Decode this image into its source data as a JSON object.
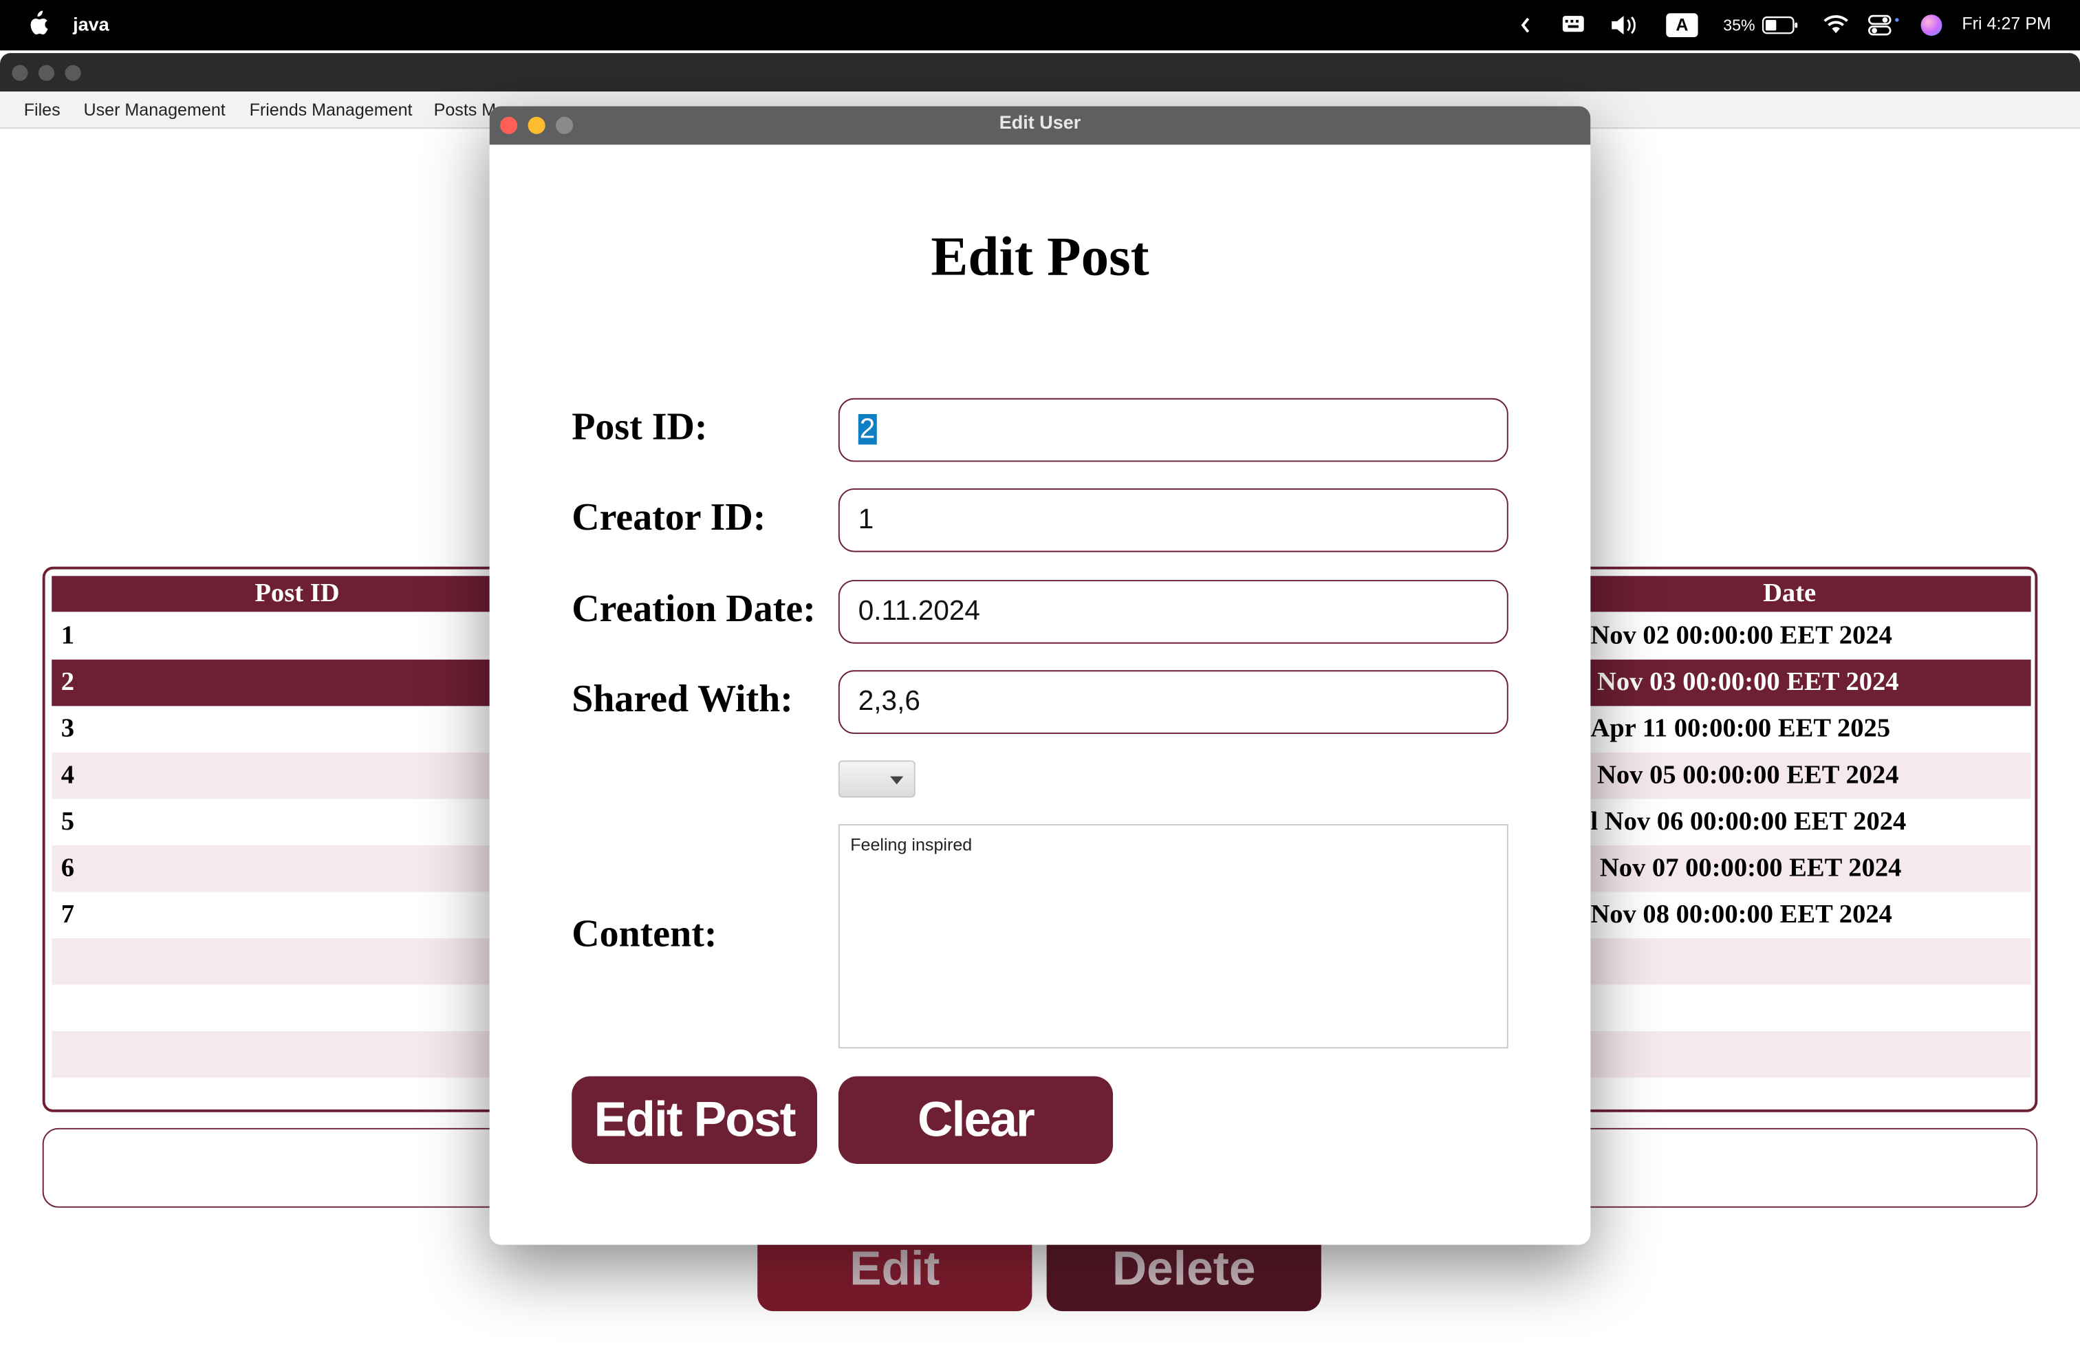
{
  "menubar": {
    "app_name": "java",
    "battery": "35%",
    "input_source": "A",
    "clock": "Fri 4:27 PM"
  },
  "app_menu": {
    "items": [
      "Files",
      "User Management",
      "Friends Management",
      "Posts M"
    ]
  },
  "table": {
    "columns": [
      "Post ID",
      "Date"
    ],
    "rows": [
      {
        "post_id": "1",
        "date": "Nov 02 00:00:00 EET 2024"
      },
      {
        "post_id": "2",
        "date": "Nov 03 00:00:00 EET 2024"
      },
      {
        "post_id": "3",
        "date": "Apr 11 00:00:00 EET 2025"
      },
      {
        "post_id": "4",
        "date": "Nov 05 00:00:00 EET 2024"
      },
      {
        "post_id": "5",
        "date": "l Nov 06 00:00:00 EET 2024"
      },
      {
        "post_id": "6",
        "date": "Nov 07 00:00:00 EET 2024"
      },
      {
        "post_id": "7",
        "date": "Nov 08 00:00:00 EET 2024"
      }
    ],
    "selected_row": 1
  },
  "background_buttons": {
    "edit": "Edit",
    "delete": "Delete"
  },
  "dialog": {
    "window_title": "Edit User",
    "heading": "Edit Post",
    "post_id_label": "Post ID:",
    "post_id_value": "2",
    "creator_id_label": "Creator ID:",
    "creator_id_value": "1",
    "creation_date_label": "Creation Date:",
    "creation_date_value": "0.11.2024",
    "shared_with_label": "Shared With:",
    "shared_with_value": "2,3,6",
    "content_label": "Content:",
    "content_value": "Feeling inspired",
    "edit_button": "Edit Post",
    "clear_button": "Clear"
  },
  "colors": {
    "accent": "#6d1f33",
    "row_alt": "#f6e9ec",
    "selection": "#0f7ec2"
  }
}
